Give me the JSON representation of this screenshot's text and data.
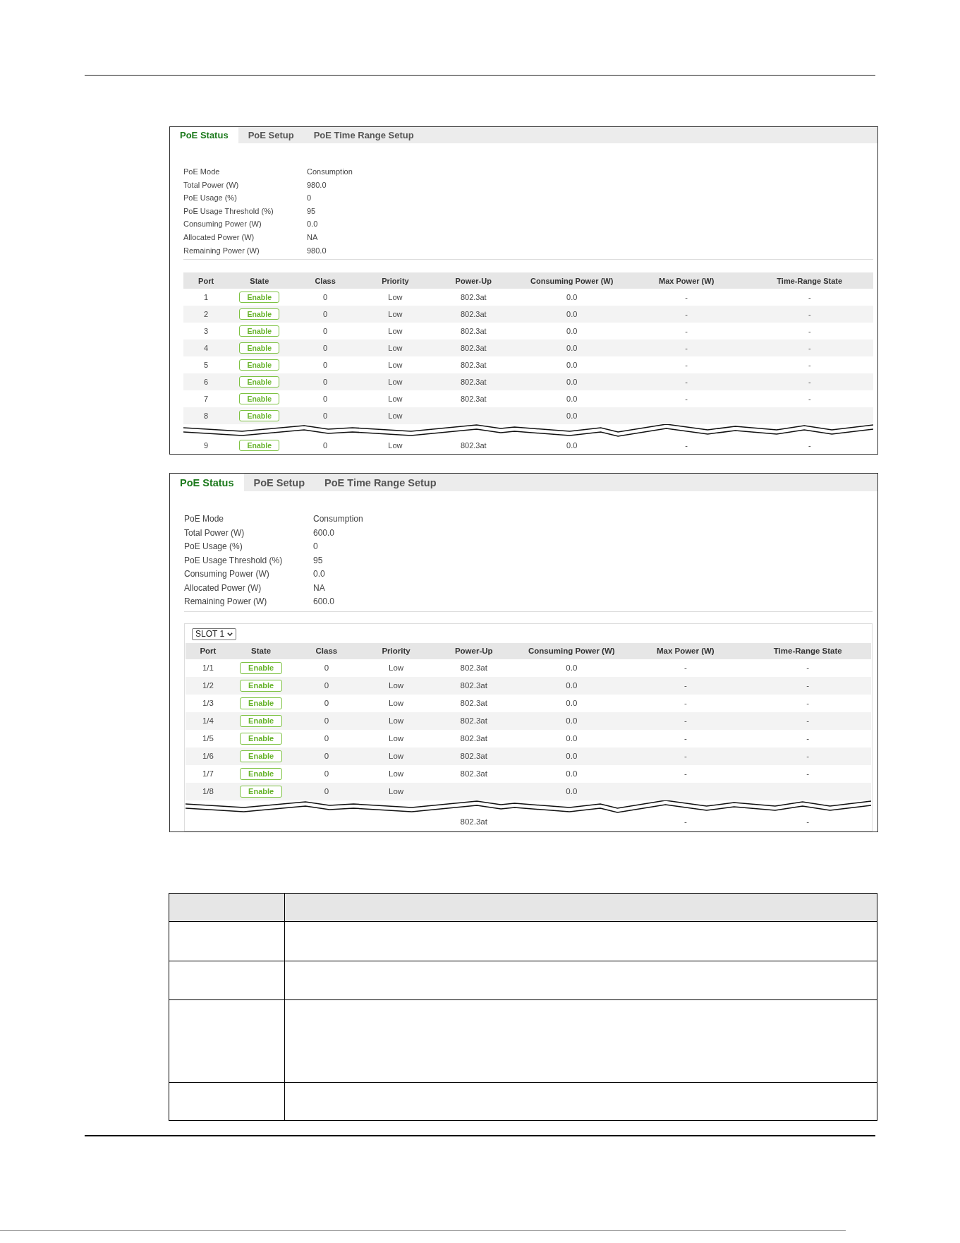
{
  "panels": [
    {
      "tabs": [
        {
          "label": "PoE Status",
          "selected": true
        },
        {
          "label": "PoE Setup",
          "selected": false
        },
        {
          "label": "PoE Time Range Setup",
          "selected": false
        }
      ],
      "summary": [
        {
          "label": "PoE Mode",
          "value": "Consumption"
        },
        {
          "label": "Total Power (W)",
          "value": "980.0"
        },
        {
          "label": "PoE Usage (%)",
          "value": "0"
        },
        {
          "label": "PoE Usage Threshold (%)",
          "value": "95"
        },
        {
          "label": "Consuming Power (W)",
          "value": "0.0"
        },
        {
          "label": "Allocated Power (W)",
          "value": "NA"
        },
        {
          "label": "Remaining Power (W)",
          "value": "980.0"
        }
      ],
      "table": {
        "columns": [
          "Port",
          "State",
          "Class",
          "Priority",
          "Power-Up",
          "Consuming Power (W)",
          "Max Power (W)",
          "Time-Range State"
        ],
        "rows": [
          {
            "port": "1",
            "state": "Enable",
            "class": "0",
            "priority": "Low",
            "power_up": "802.3at",
            "consuming_power": "0.0",
            "max_power": "-",
            "time_range_state": "-"
          },
          {
            "port": "2",
            "state": "Enable",
            "class": "0",
            "priority": "Low",
            "power_up": "802.3at",
            "consuming_power": "0.0",
            "max_power": "-",
            "time_range_state": "-"
          },
          {
            "port": "3",
            "state": "Enable",
            "class": "0",
            "priority": "Low",
            "power_up": "802.3at",
            "consuming_power": "0.0",
            "max_power": "-",
            "time_range_state": "-"
          },
          {
            "port": "4",
            "state": "Enable",
            "class": "0",
            "priority": "Low",
            "power_up": "802.3at",
            "consuming_power": "0.0",
            "max_power": "-",
            "time_range_state": "-"
          },
          {
            "port": "5",
            "state": "Enable",
            "class": "0",
            "priority": "Low",
            "power_up": "802.3at",
            "consuming_power": "0.0",
            "max_power": "-",
            "time_range_state": "-"
          },
          {
            "port": "6",
            "state": "Enable",
            "class": "0",
            "priority": "Low",
            "power_up": "802.3at",
            "consuming_power": "0.0",
            "max_power": "-",
            "time_range_state": "-"
          },
          {
            "port": "7",
            "state": "Enable",
            "class": "0",
            "priority": "Low",
            "power_up": "802.3at",
            "consuming_power": "0.0",
            "max_power": "-",
            "time_range_state": "-"
          },
          {
            "port": "8",
            "state": "Enable",
            "class": "0",
            "priority": "Low",
            "consuming_power": "0.0"
          }
        ],
        "rows_after_break": [
          {
            "port": "9",
            "state": "Enable",
            "class": "0",
            "priority": "Low",
            "power_up": "802.3at",
            "consuming_power": "0.0",
            "max_power": "-",
            "time_range_state": "-"
          }
        ]
      }
    },
    {
      "tabs": [
        {
          "label": "PoE Status",
          "selected": true
        },
        {
          "label": "PoE Setup",
          "selected": false
        },
        {
          "label": "PoE Time Range Setup",
          "selected": false
        }
      ],
      "summary": [
        {
          "label": "PoE Mode",
          "value": "Consumption"
        },
        {
          "label": "Total Power (W)",
          "value": "600.0"
        },
        {
          "label": "PoE Usage (%)",
          "value": "0"
        },
        {
          "label": "PoE Usage Threshold (%)",
          "value": "95"
        },
        {
          "label": "Consuming Power (W)",
          "value": "0.0"
        },
        {
          "label": "Allocated Power (W)",
          "value": "NA"
        },
        {
          "label": "Remaining Power (W)",
          "value": "600.0"
        }
      ],
      "slot_select": {
        "value": "SLOT 1"
      },
      "table": {
        "columns": [
          "Port",
          "State",
          "Class",
          "Priority",
          "Power-Up",
          "Consuming Power (W)",
          "Max Power (W)",
          "Time-Range State"
        ],
        "rows": [
          {
            "port": "1/1",
            "state": "Enable",
            "class": "0",
            "priority": "Low",
            "power_up": "802.3at",
            "consuming_power": "0.0",
            "max_power": "-",
            "time_range_state": "-"
          },
          {
            "port": "1/2",
            "state": "Enable",
            "class": "0",
            "priority": "Low",
            "power_up": "802.3at",
            "consuming_power": "0.0",
            "max_power": "-",
            "time_range_state": "-"
          },
          {
            "port": "1/3",
            "state": "Enable",
            "class": "0",
            "priority": "Low",
            "power_up": "802.3at",
            "consuming_power": "0.0",
            "max_power": "-",
            "time_range_state": "-"
          },
          {
            "port": "1/4",
            "state": "Enable",
            "class": "0",
            "priority": "Low",
            "power_up": "802.3at",
            "consuming_power": "0.0",
            "max_power": "-",
            "time_range_state": "-"
          },
          {
            "port": "1/5",
            "state": "Enable",
            "class": "0",
            "priority": "Low",
            "power_up": "802.3at",
            "consuming_power": "0.0",
            "max_power": "-",
            "time_range_state": "-"
          },
          {
            "port": "1/6",
            "state": "Enable",
            "class": "0",
            "priority": "Low",
            "power_up": "802.3at",
            "consuming_power": "0.0",
            "max_power": "-",
            "time_range_state": "-"
          },
          {
            "port": "1/7",
            "state": "Enable",
            "class": "0",
            "priority": "Low",
            "power_up": "802.3at",
            "consuming_power": "0.0",
            "max_power": "-",
            "time_range_state": "-"
          },
          {
            "port": "1/8",
            "state": "Enable",
            "class": "0",
            "priority": "Low",
            "consuming_power": "0.0"
          }
        ],
        "rows_after_break": [
          {
            "power_up": "802.3at",
            "max_power": "-",
            "time_range_state": "-"
          }
        ]
      }
    }
  ]
}
